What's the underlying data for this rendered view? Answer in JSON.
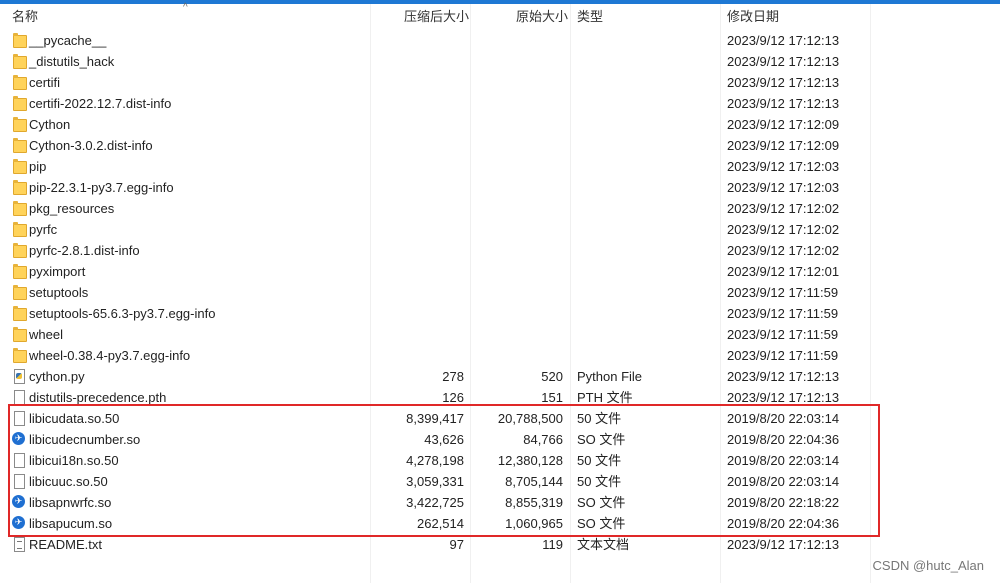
{
  "columns": {
    "name": "名称",
    "compressed": "压缩后大小",
    "original": "原始大小",
    "type": "类型",
    "modified": "修改日期"
  },
  "sort_indicator": "^",
  "rows": [
    {
      "name": "__pycache__",
      "compressed": "",
      "original": "",
      "type": "",
      "modified": "2023/9/12 17:12:13",
      "icon": "folder-icon"
    },
    {
      "name": "_distutils_hack",
      "compressed": "",
      "original": "",
      "type": "",
      "modified": "2023/9/12 17:12:13",
      "icon": "folder-icon"
    },
    {
      "name": "certifi",
      "compressed": "",
      "original": "",
      "type": "",
      "modified": "2023/9/12 17:12:13",
      "icon": "folder-icon"
    },
    {
      "name": "certifi-2022.12.7.dist-info",
      "compressed": "",
      "original": "",
      "type": "",
      "modified": "2023/9/12 17:12:13",
      "icon": "folder-icon"
    },
    {
      "name": "Cython",
      "compressed": "",
      "original": "",
      "type": "",
      "modified": "2023/9/12 17:12:09",
      "icon": "folder-icon"
    },
    {
      "name": "Cython-3.0.2.dist-info",
      "compressed": "",
      "original": "",
      "type": "",
      "modified": "2023/9/12 17:12:09",
      "icon": "folder-icon"
    },
    {
      "name": "pip",
      "compressed": "",
      "original": "",
      "type": "",
      "modified": "2023/9/12 17:12:03",
      "icon": "folder-icon"
    },
    {
      "name": "pip-22.3.1-py3.7.egg-info",
      "compressed": "",
      "original": "",
      "type": "",
      "modified": "2023/9/12 17:12:03",
      "icon": "folder-icon"
    },
    {
      "name": "pkg_resources",
      "compressed": "",
      "original": "",
      "type": "",
      "modified": "2023/9/12 17:12:02",
      "icon": "folder-icon"
    },
    {
      "name": "pyrfc",
      "compressed": "",
      "original": "",
      "type": "",
      "modified": "2023/9/12 17:12:02",
      "icon": "folder-icon"
    },
    {
      "name": "pyrfc-2.8.1.dist-info",
      "compressed": "",
      "original": "",
      "type": "",
      "modified": "2023/9/12 17:12:02",
      "icon": "folder-icon"
    },
    {
      "name": "pyximport",
      "compressed": "",
      "original": "",
      "type": "",
      "modified": "2023/9/12 17:12:01",
      "icon": "folder-icon"
    },
    {
      "name": "setuptools",
      "compressed": "",
      "original": "",
      "type": "",
      "modified": "2023/9/12 17:11:59",
      "icon": "folder-icon"
    },
    {
      "name": "setuptools-65.6.3-py3.7.egg-info",
      "compressed": "",
      "original": "",
      "type": "",
      "modified": "2023/9/12 17:11:59",
      "icon": "folder-icon"
    },
    {
      "name": "wheel",
      "compressed": "",
      "original": "",
      "type": "",
      "modified": "2023/9/12 17:11:59",
      "icon": "folder-icon"
    },
    {
      "name": "wheel-0.38.4-py3.7.egg-info",
      "compressed": "",
      "original": "",
      "type": "",
      "modified": "2023/9/12 17:11:59",
      "icon": "folder-icon"
    },
    {
      "name": "cython.py",
      "compressed": "278",
      "original": "520",
      "type": "Python File",
      "modified": "2023/9/12 17:12:13",
      "icon": "python-file-icon"
    },
    {
      "name": "distutils-precedence.pth",
      "compressed": "126",
      "original": "151",
      "type": "PTH 文件",
      "modified": "2023/9/12 17:12:13",
      "icon": "file-icon"
    },
    {
      "name": "libicudata.so.50",
      "compressed": "8,399,417",
      "original": "20,788,500",
      "type": "50 文件",
      "modified": "2019/8/20 22:03:14",
      "icon": "file-icon"
    },
    {
      "name": "libicudecnumber.so",
      "compressed": "43,626",
      "original": "84,766",
      "type": "SO 文件",
      "modified": "2019/8/20 22:04:36",
      "icon": "so-file-icon"
    },
    {
      "name": "libicui18n.so.50",
      "compressed": "4,278,198",
      "original": "12,380,128",
      "type": "50 文件",
      "modified": "2019/8/20 22:03:14",
      "icon": "file-icon"
    },
    {
      "name": "libicuuc.so.50",
      "compressed": "3,059,331",
      "original": "8,705,144",
      "type": "50 文件",
      "modified": "2019/8/20 22:03:14",
      "icon": "file-icon"
    },
    {
      "name": "libsapnwrfc.so",
      "compressed": "3,422,725",
      "original": "8,855,319",
      "type": "SO 文件",
      "modified": "2019/8/20 22:18:22",
      "icon": "so-file-icon"
    },
    {
      "name": "libsapucum.so",
      "compressed": "262,514",
      "original": "1,060,965",
      "type": "SO 文件",
      "modified": "2019/8/20 22:04:36",
      "icon": "so-file-icon"
    },
    {
      "name": "README.txt",
      "compressed": "97",
      "original": "119",
      "type": "文本文档",
      "modified": "2023/9/12 17:12:13",
      "icon": "text-file-icon"
    }
  ],
  "watermark": "CSDN @hutc_Alan",
  "colors": {
    "highlight": "#e02828",
    "folder": "#ffd35a",
    "so_icon": "#1f6fd1",
    "top_bar": "#1e78d4"
  }
}
